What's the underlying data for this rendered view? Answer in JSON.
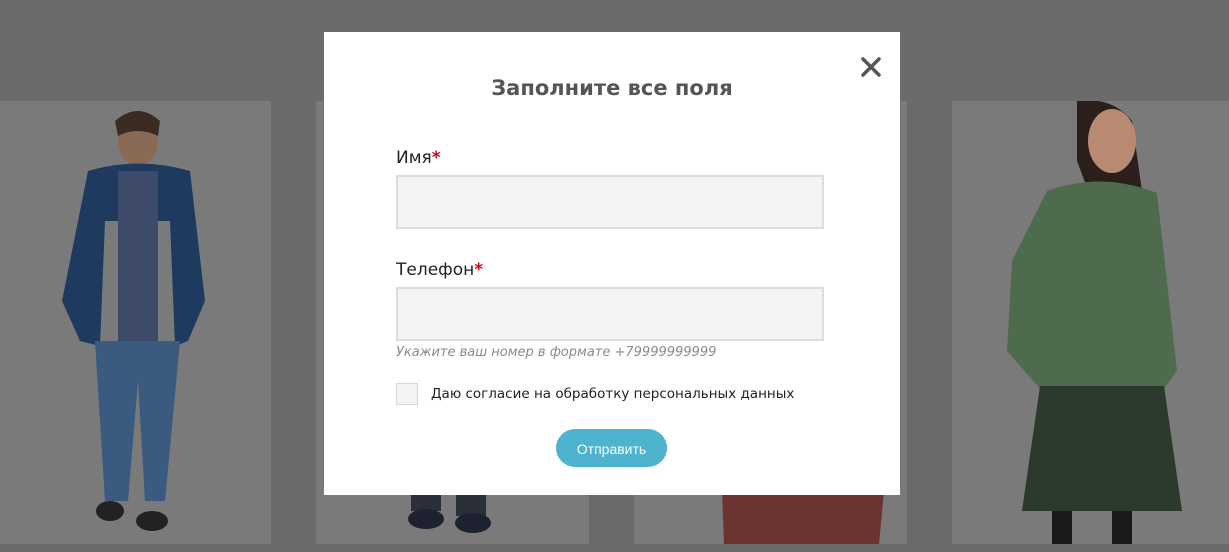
{
  "modal": {
    "title": "Заполните все поля",
    "close_icon": "close-icon",
    "name_label": "Имя",
    "phone_label": "Телефон",
    "required_mark": "*",
    "name_value": "",
    "phone_value": "",
    "phone_hint": "Укажите ваш номер в формате +79999999999",
    "consent_label": "Даю согласие на обработку персональных данных",
    "consent_checked": false,
    "submit_label": "Отправить"
  },
  "colors": {
    "overlay": "#6b6b6b",
    "accent": "#4db3cf",
    "required": "#d0021b",
    "field_bg": "#f3f3f3"
  },
  "background_products": [
    {
      "description_icon": "product-photo-man-blue-jacket"
    },
    {
      "description_icon": "product-photo-boots"
    },
    {
      "description_icon": "product-photo-red-coat"
    },
    {
      "description_icon": "product-photo-woman-green-jacket"
    }
  ]
}
